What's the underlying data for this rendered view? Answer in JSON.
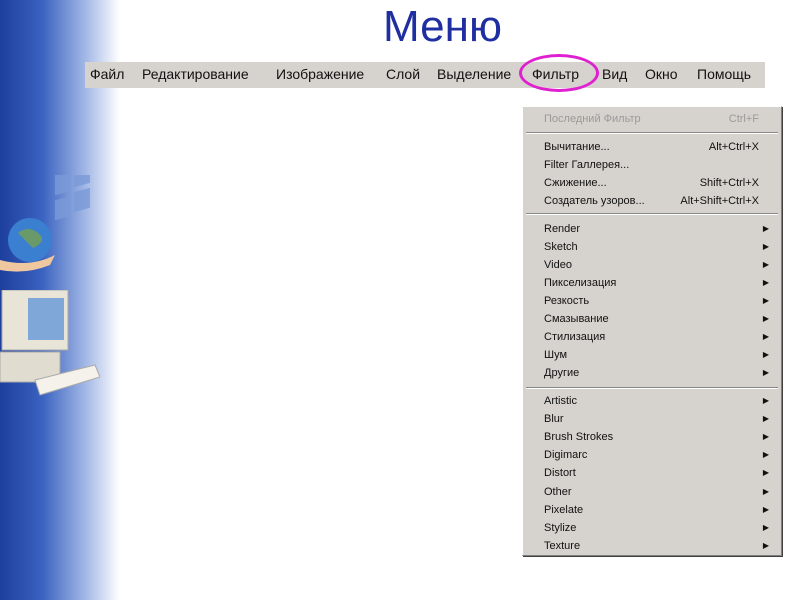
{
  "title": "Меню",
  "menubar": [
    "Файл",
    "Редактирование",
    "Изображение",
    "Слой",
    "Выделение",
    "Фильтр",
    "Вид",
    "Окно",
    "Помощь"
  ],
  "colors": {
    "highlight_ring": "#e020d0",
    "title": "#1f2ea0",
    "menu_bg": "#d6d3ce"
  },
  "dropdown": {
    "last": {
      "label": "Последний Фильтр",
      "shortcut": "Ctrl+F"
    },
    "group1": [
      {
        "label": "Вычитание...",
        "shortcut": "Alt+Ctrl+X"
      },
      {
        "label": "Filter Галлерея...",
        "shortcut": ""
      },
      {
        "label": "Сжижение...",
        "shortcut": "Shift+Ctrl+X"
      },
      {
        "label": "Создатель узоров...",
        "shortcut": "Alt+Shift+Ctrl+X"
      }
    ],
    "group2": [
      "Render",
      "Sketch",
      "Video",
      "Пикселизация",
      "Резкость",
      "Смазывание",
      "Стилизация",
      "Шум",
      "Другие"
    ],
    "group3": [
      "Artistic",
      "Blur",
      "Brush Strokes",
      "Digimarc",
      "Distort",
      "Other",
      "Pixelate",
      "Stylize",
      "Texture"
    ],
    "arrow": "▶"
  }
}
